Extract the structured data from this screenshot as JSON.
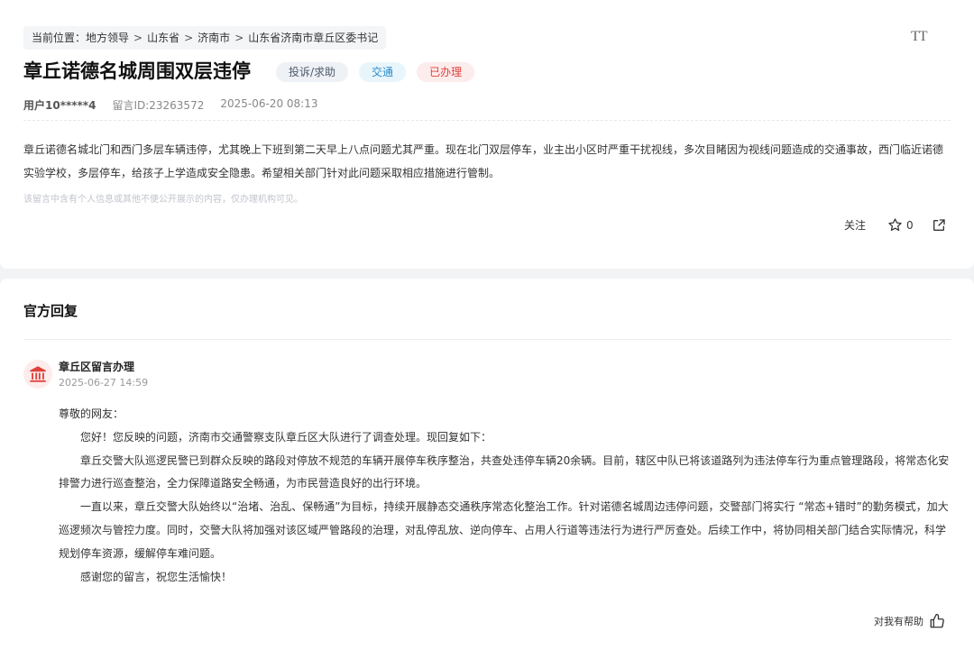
{
  "breadcrumb": {
    "prefix": "当前位置：",
    "items": [
      "地方领导",
      "山东省",
      "济南市",
      "山东省济南市章丘区委书记"
    ],
    "separator": ">"
  },
  "font_toggle_label": "TT",
  "message": {
    "title": "章丘诺德名城周围双层违停",
    "tags": [
      "投诉/求助",
      "交通",
      "已办理"
    ],
    "user": "用户10*****4",
    "message_id": "留言ID:23263572",
    "datetime": "2025-06-20 08:13",
    "content": "章丘诺德名城北门和西门多层车辆违停，尤其晚上下班到第二天早上八点问题尤其严重。现在北门双层停车，业主出小区时严重干扰视线，多次目睹因为视线问题造成的交通事故，西门临近诺德实验学校，多层停车，给孩子上学造成安全隐患。希望相关部门针对此问题采取相应措施进行管制。",
    "privacy_notice": "该留言中含有个人信息或其他不便公开展示的内容，仅办理机构可见。"
  },
  "actions": {
    "follow_label": "关注",
    "star_count": "0"
  },
  "reply": {
    "heading": "官方回复",
    "org_name": "章丘区留言办理",
    "datetime": "2025-06-27 14:59",
    "greeting": "尊敬的网友：",
    "paragraphs": [
      "您好！您反映的问题，济南市交通警察支队章丘区大队进行了调查处理。现回复如下：",
      "章丘交警大队巡逻民警已到群众反映的路段对停放不规范的车辆开展停车秩序整治，共查处违停车辆20余辆。目前，辖区中队已将该道路列为违法停车行为重点管理路段，将常态化安排警力进行巡查整治，全力保障道路安全畅通，为市民营造良好的出行环境。",
      "一直以来，章丘交警大队始终以“治堵、治乱、保畅通”为目标，持续开展静态交通秩序常态化整治工作。针对诺德名城周边违停问题，交警部门将实行 “常态+错时”的勤务模式，加大巡逻频次与管控力度。同时，交警大队将加强对该区域严管路段的治理，对乱停乱放、逆向停车、占用人行道等违法行为进行严厉查处。后续工作中，将协同相关部门结合实际情况，科学规划停车资源，缓解停车难问题。",
      "感谢您的留言，祝您生活愉快！"
    ],
    "helpful_label": "对我有帮助"
  },
  "colors": {
    "tag_category_bg": "#eef1f6",
    "tag_traffic_bg": "#e8f6fb",
    "tag_traffic_fg": "#2a8bc8",
    "tag_status_bg": "#fdecec",
    "tag_status_fg": "#e0403a",
    "avatar_icon": "#e0403a"
  },
  "icons": {
    "font_toggle": "text-size-icon",
    "star": "star-icon",
    "share": "share-icon",
    "avatar": "government-building-icon",
    "helpful": "thumbs-up-icon"
  }
}
